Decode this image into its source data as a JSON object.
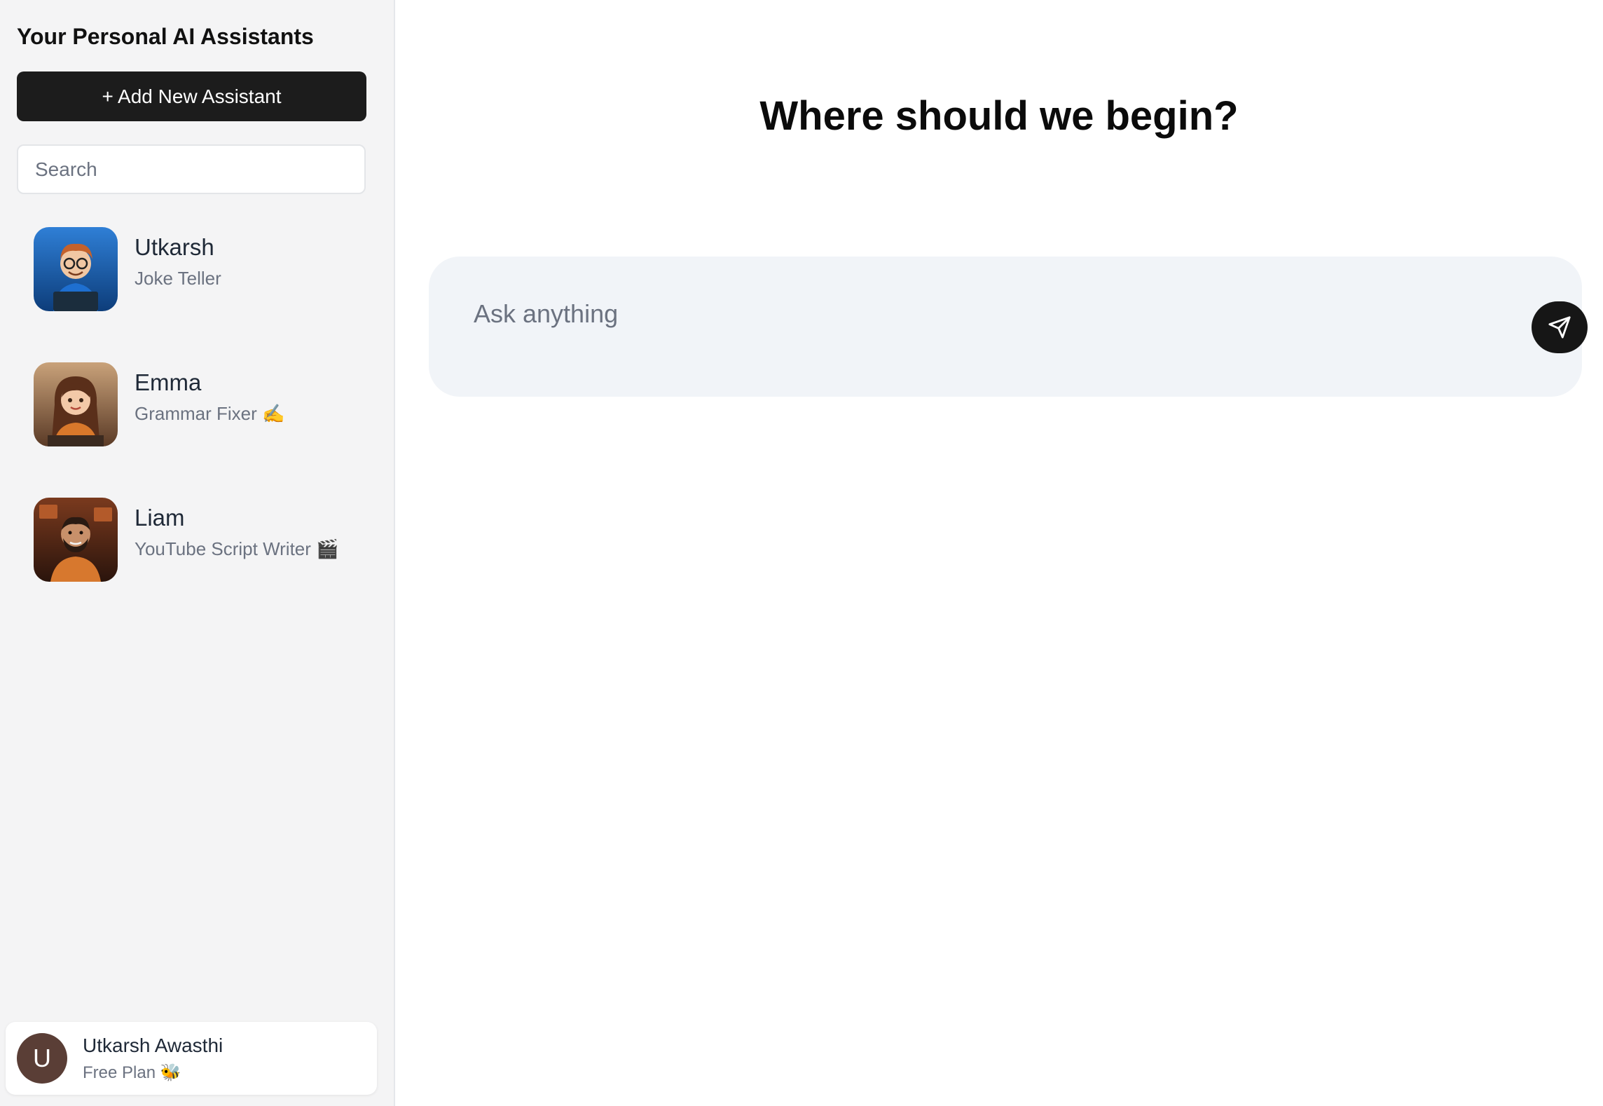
{
  "sidebar": {
    "title": "Your Personal AI Assistants",
    "add_button_label": "+ Add New Assistant",
    "search_placeholder": "Search",
    "assistants": [
      {
        "name": "Utkarsh",
        "role": "Joke Teller",
        "avatar_icon": "cartoon-developer-avatar"
      },
      {
        "name": "Emma",
        "role": "Grammar Fixer ✍️",
        "avatar_icon": "cartoon-writer-avatar"
      },
      {
        "name": "Liam",
        "role": "YouTube Script Writer 🎬",
        "avatar_icon": "cartoon-creator-avatar"
      }
    ]
  },
  "user": {
    "initial": "U",
    "name": "Utkarsh Awasthi",
    "plan": "Free Plan 🐝"
  },
  "main": {
    "heading": "Where should we begin?",
    "input_placeholder": "Ask anything",
    "send_icon": "send-icon"
  },
  "colors": {
    "sidebar_bg": "#f4f4f5",
    "button_dark": "#1c1c1c",
    "composer_bg": "#f1f4f8",
    "user_avatar_bg": "#5a3e36"
  }
}
